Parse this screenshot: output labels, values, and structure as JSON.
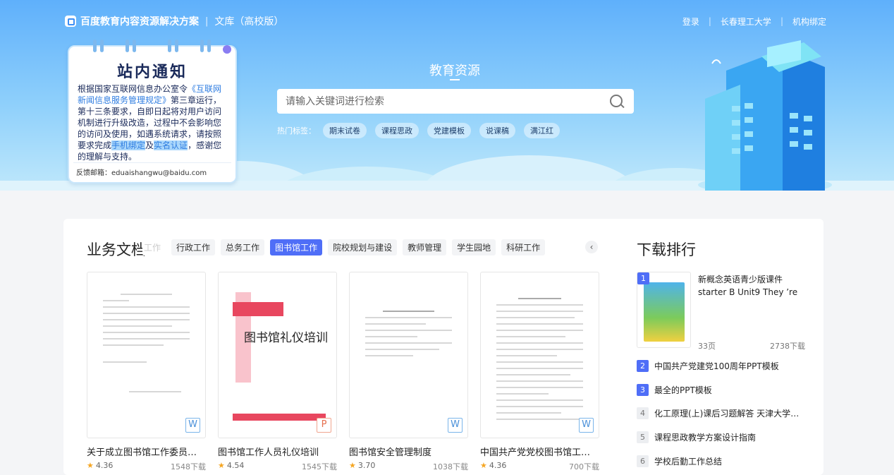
{
  "header": {
    "brand": "百度教育内容资源解决方案",
    "sub_brand": "文库（高校版）",
    "links": [
      "登录",
      "长春理工大学",
      "机构绑定"
    ]
  },
  "notice": {
    "title": "站内通知",
    "body_1": "根据国家互联网信息办公室令",
    "body_link": "《互联网新闻信息服务管理规定》",
    "body_2": "第三章运行，第十三条要求，自即日起将对用户访问机制进行升级改造，过程中不会影响您的访问及使用，如遇系统请求，请按照要求完成",
    "hl_1": "手机绑定",
    "body_3": "及",
    "hl_2": "实名认证",
    "body_4": "，感谢您的理解与支持。",
    "email": "反馈邮箱：eduaishangwu@baidu.com"
  },
  "search": {
    "title": "教育资源",
    "placeholder": "请输入关键词进行检索",
    "hot_label": "热门标签：",
    "hot_tags": [
      "期末试卷",
      "课程思政",
      "党建模板",
      "说课稿",
      "满江红"
    ]
  },
  "docs_section": {
    "title": "业务文档",
    "tabs": [
      "工作",
      "行政工作",
      "总务工作",
      "图书馆工作",
      "院校规划与建设",
      "教师管理",
      "学生园地",
      "科研工作"
    ],
    "active_tab": "图书馆工作",
    "docs": [
      {
        "title": "关于成立图书馆工作委员会的通知",
        "type": "W",
        "rating": "4.36",
        "downloads": "1548下载"
      },
      {
        "title": "图书馆工作人员礼仪培训",
        "type": "P",
        "rating": "4.54",
        "downloads": "1545下载",
        "cover_text": "图书馆礼仪培训"
      },
      {
        "title": "图书馆安全管理制度",
        "type": "W",
        "rating": "3.70",
        "downloads": "1038下载"
      },
      {
        "title": "中国共产党党校图书馆工作条例",
        "type": "W",
        "rating": "4.36",
        "downloads": "700下载"
      }
    ]
  },
  "ranking": {
    "title": "下载排行",
    "top": {
      "rank": "1",
      "title": "新概念英语青少版课件starter B Unit9 They ’re",
      "pages": "33页",
      "downloads": "2738下载"
    },
    "items": [
      {
        "rank": "2",
        "title": "中国共产党建党100周年PPT模板"
      },
      {
        "rank": "3",
        "title": "最全的PPT模板"
      },
      {
        "rank": "4",
        "title": "化工原理(上)课后习题解答 天津大学化工学院"
      },
      {
        "rank": "5",
        "title": "课程思政教学方案设计指南"
      },
      {
        "rank": "6",
        "title": "学校后勤工作总结"
      }
    ]
  },
  "colors": {
    "accent": "#4f6ef7",
    "hero_top": "#5fb0fb",
    "star": "#f5a623",
    "ppt": "#e6704f",
    "word": "#4a90d9"
  }
}
